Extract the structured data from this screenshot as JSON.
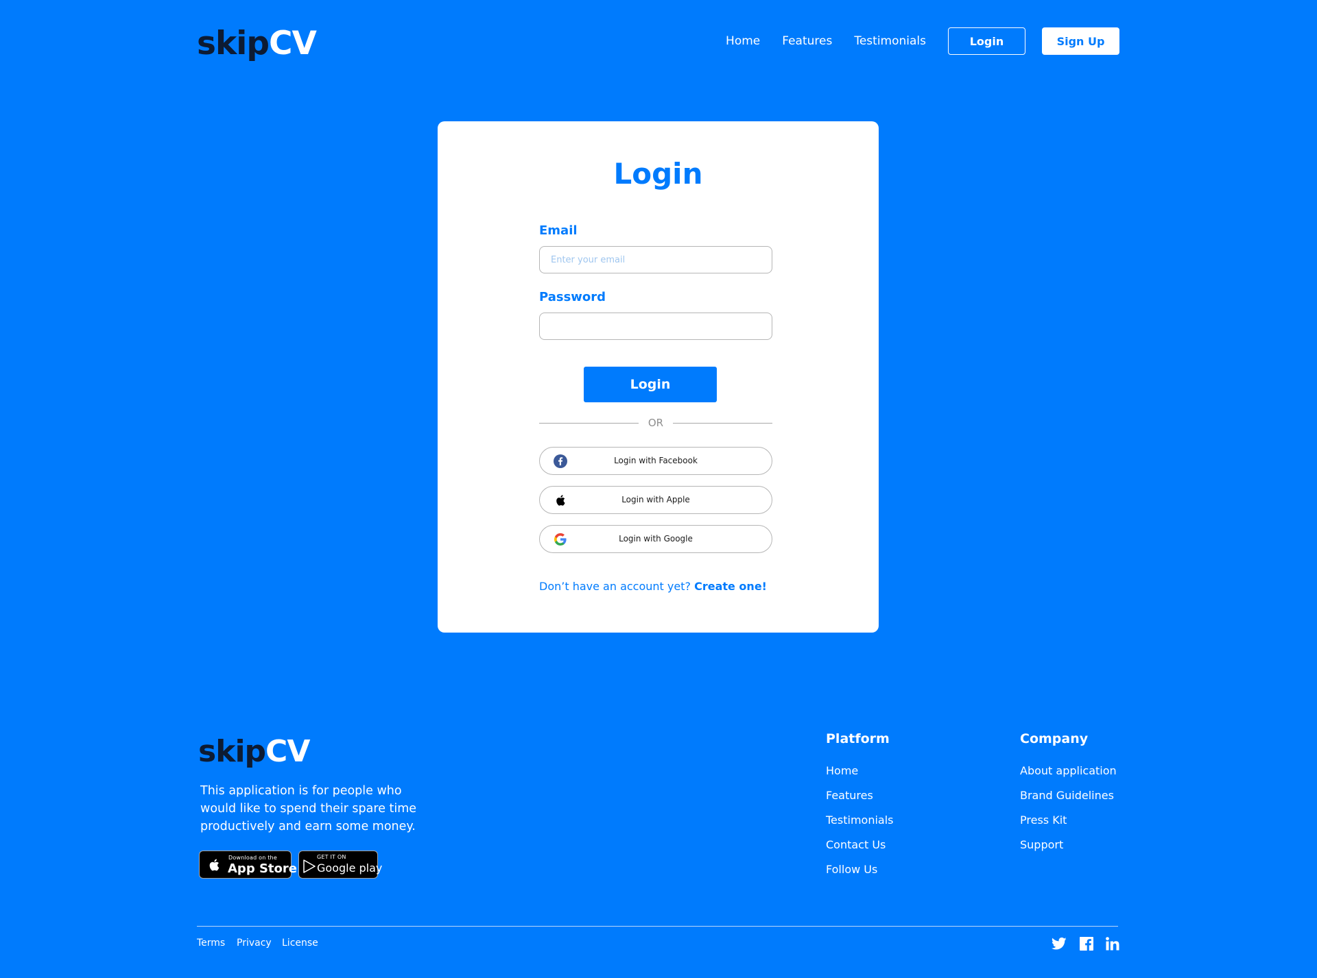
{
  "brand": {
    "part1": "skip",
    "part2": "CV"
  },
  "nav": {
    "links": [
      "Home",
      "Features",
      "Testimonials"
    ],
    "login_label": "Login",
    "signup_label": "Sign Up"
  },
  "login_form": {
    "title": "Login",
    "email_label": "Email",
    "email_placeholder": "Enter your email",
    "email_value": "",
    "password_label": "Password",
    "password_value": "",
    "submit_label": "Login",
    "or_text": "OR",
    "social": {
      "facebook": "Login with Facebook",
      "apple": "Login with Apple",
      "google": "Login with Google"
    },
    "no_account_text": "Don’t have an account yet?",
    "create_link": "Create one!"
  },
  "footer": {
    "description": "This application is for people who would like to spend their spare time productively and earn some money.",
    "app_store": {
      "small": "Download on the",
      "big": "App Store"
    },
    "google_play": {
      "small": "GET IT ON",
      "big": "Google play"
    },
    "platform": {
      "title": "Platform",
      "links": [
        "Home",
        "Features",
        "Testimonials",
        "Contact Us",
        "Follow Us"
      ]
    },
    "company": {
      "title": "Company",
      "links": [
        "About application",
        "Brand Guidelines",
        "Press Kit",
        "Support"
      ]
    },
    "legal": [
      "Terms",
      "Privacy",
      "License"
    ],
    "social_icons": [
      "twitter-icon",
      "facebook-icon",
      "linkedin-icon"
    ]
  },
  "colors": {
    "background": "#007bfd",
    "card": "#ffffff",
    "accent": "#007bfd",
    "logo_dark": "#0d1b33"
  }
}
